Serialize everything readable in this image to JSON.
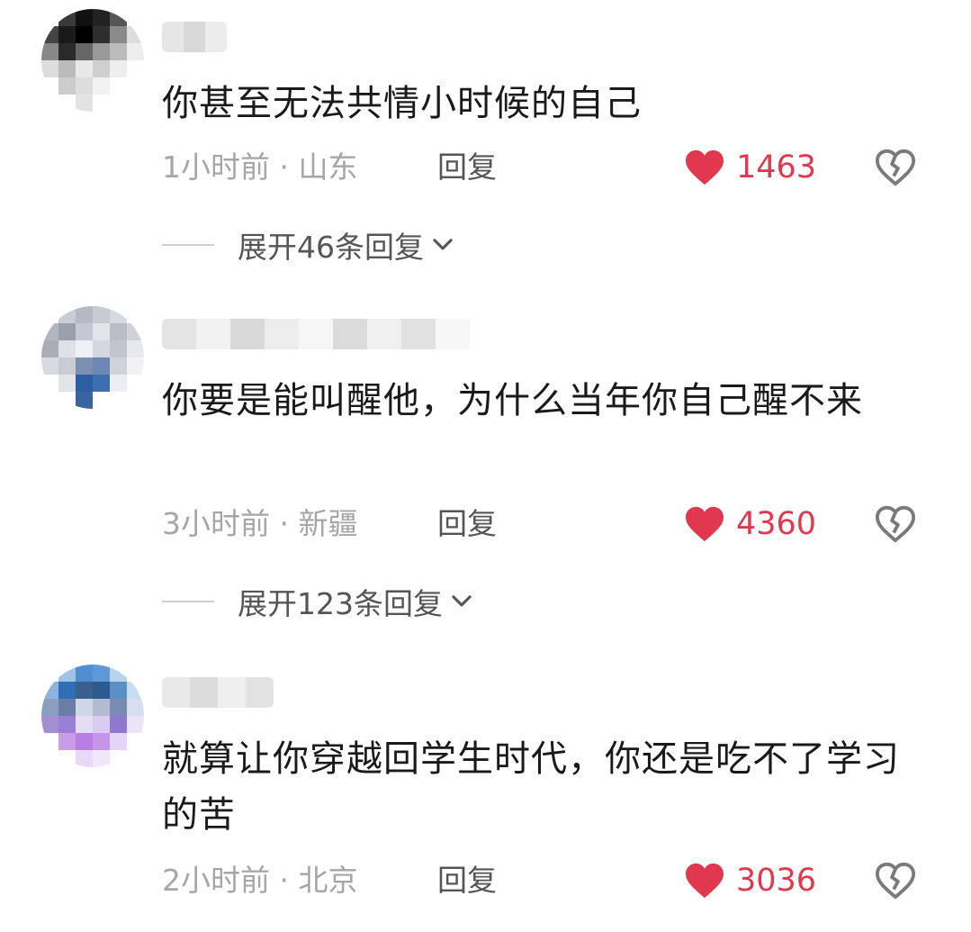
{
  "colors": {
    "like_red": "#e0394f",
    "muted_gray": "#a6a6a6",
    "reply_gray": "#555555",
    "text": "#1a1a1a"
  },
  "icons": {
    "like": "heart-icon",
    "dislike": "broken-heart-icon",
    "expand": "chevron-down-icon"
  },
  "comments": [
    {
      "text": "你甚至无法共情小时候的自己",
      "time_location": "1小时前 · 山东",
      "reply_label": "回复",
      "likes": "1463",
      "expand_label": "展开46条回复"
    },
    {
      "text": "你要是能叫醒他，为什么当年你自己醒不来",
      "time_location": "3小时前 · 新疆",
      "reply_label": "回复",
      "likes": "4360",
      "expand_label": "展开123条回复"
    },
    {
      "text": "就算让你穿越回学生时代，你还是吃不了学习的苦",
      "time_location": "2小时前 · 北京",
      "reply_label": "回复",
      "likes": "3036"
    }
  ]
}
